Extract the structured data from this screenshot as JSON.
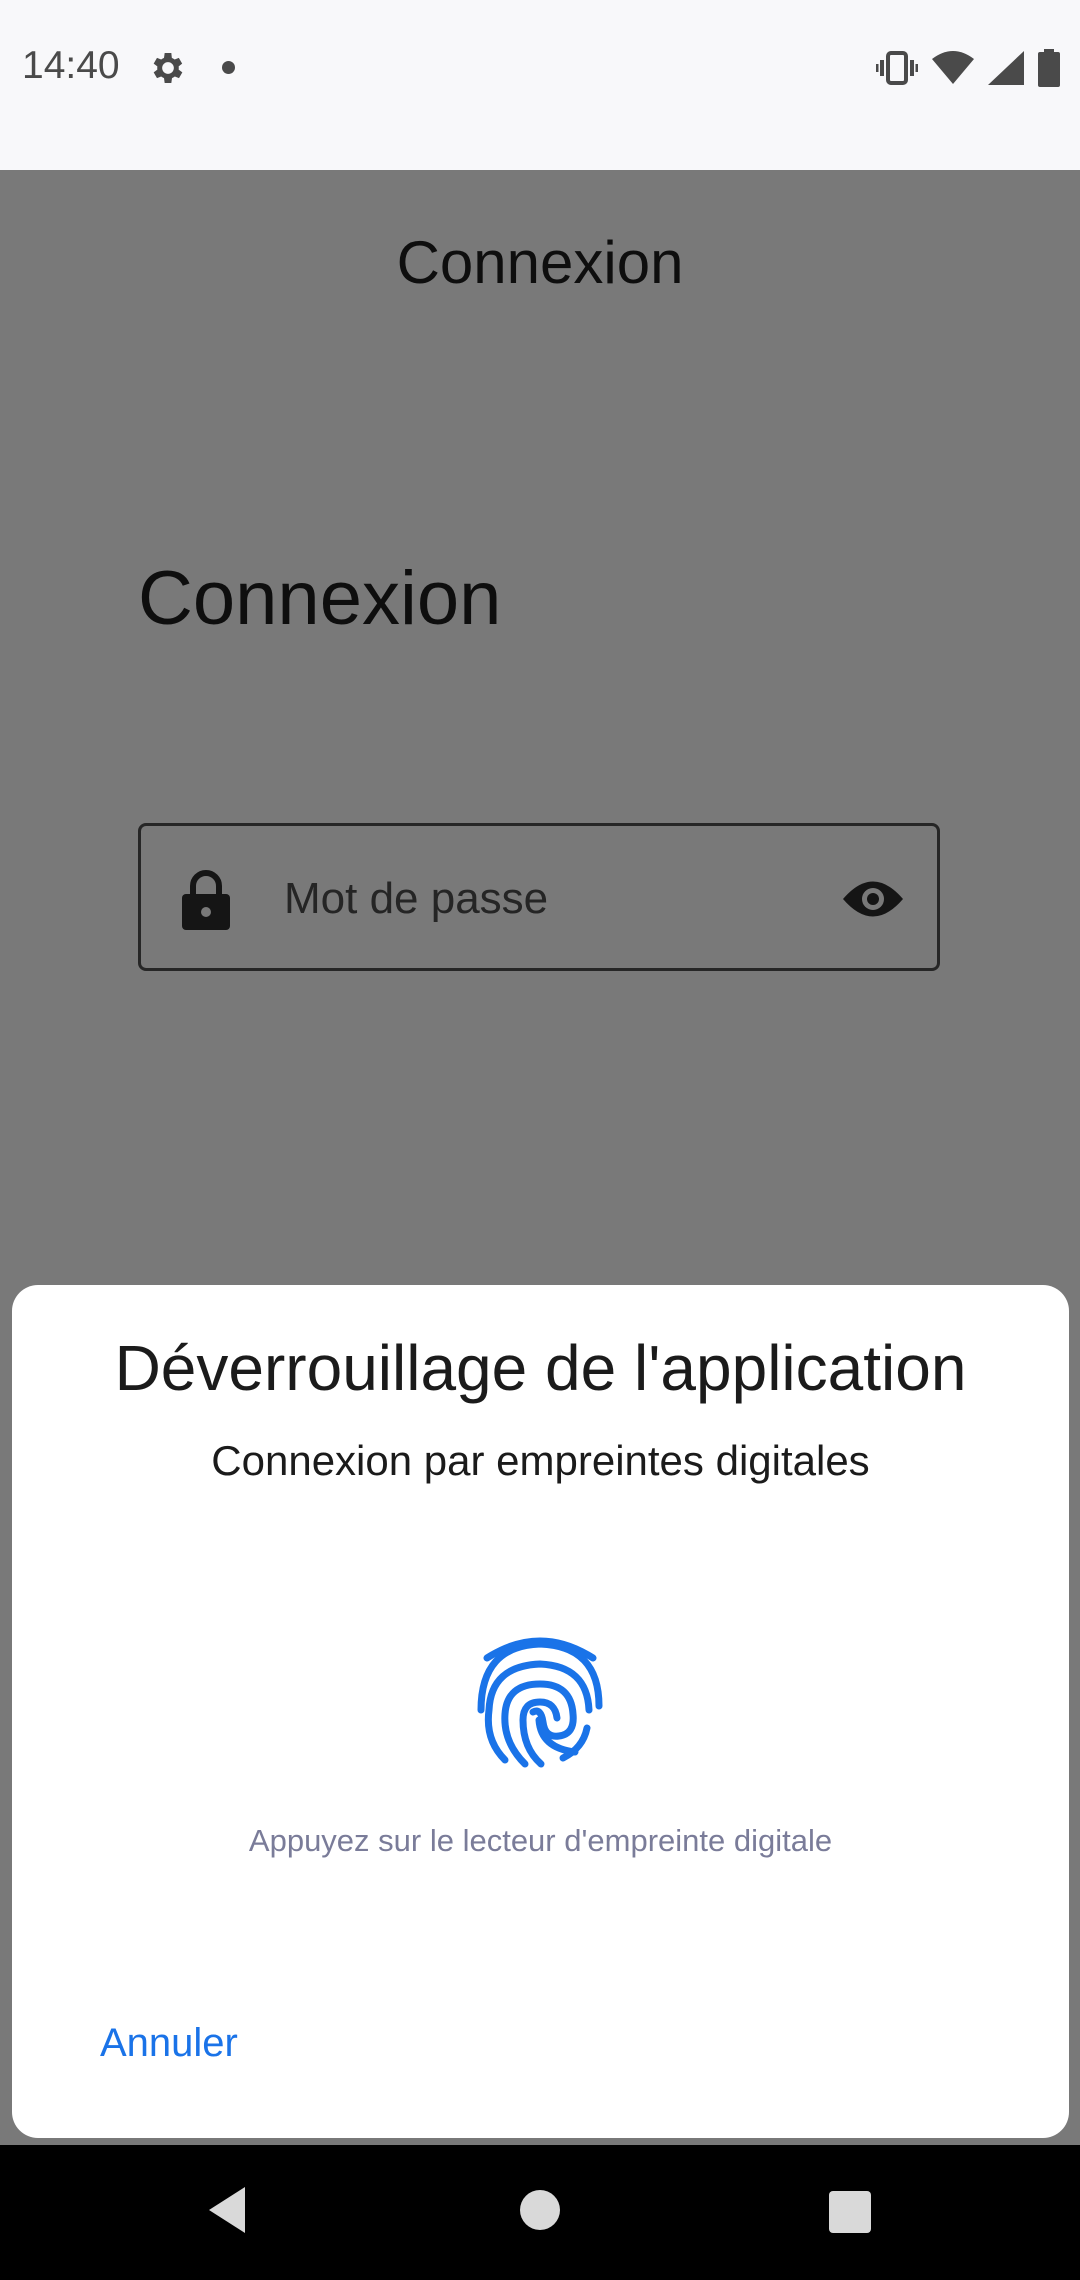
{
  "status_bar": {
    "time": "14:40",
    "icons": [
      "gear-icon",
      "notification-dot",
      "vibrate-icon",
      "wifi-icon",
      "signal-icon",
      "battery-icon"
    ]
  },
  "app": {
    "toolbar_title": "Connexion",
    "heading": "Connexion",
    "password_field": {
      "placeholder": "Mot de passe",
      "leading_icon": "lock-icon",
      "trailing_icon": "eye-icon"
    }
  },
  "biometric_prompt": {
    "title": "Déverrouillage de l'application",
    "subtitle": "Connexion par empreintes digitales",
    "icon": "fingerprint-icon",
    "hint": "Appuyez sur le lecteur d'empreinte digitale",
    "cancel_label": "Annuler",
    "accent_color": "#1a73e8"
  },
  "nav_bar": {
    "buttons": [
      "back",
      "home",
      "recents"
    ]
  }
}
